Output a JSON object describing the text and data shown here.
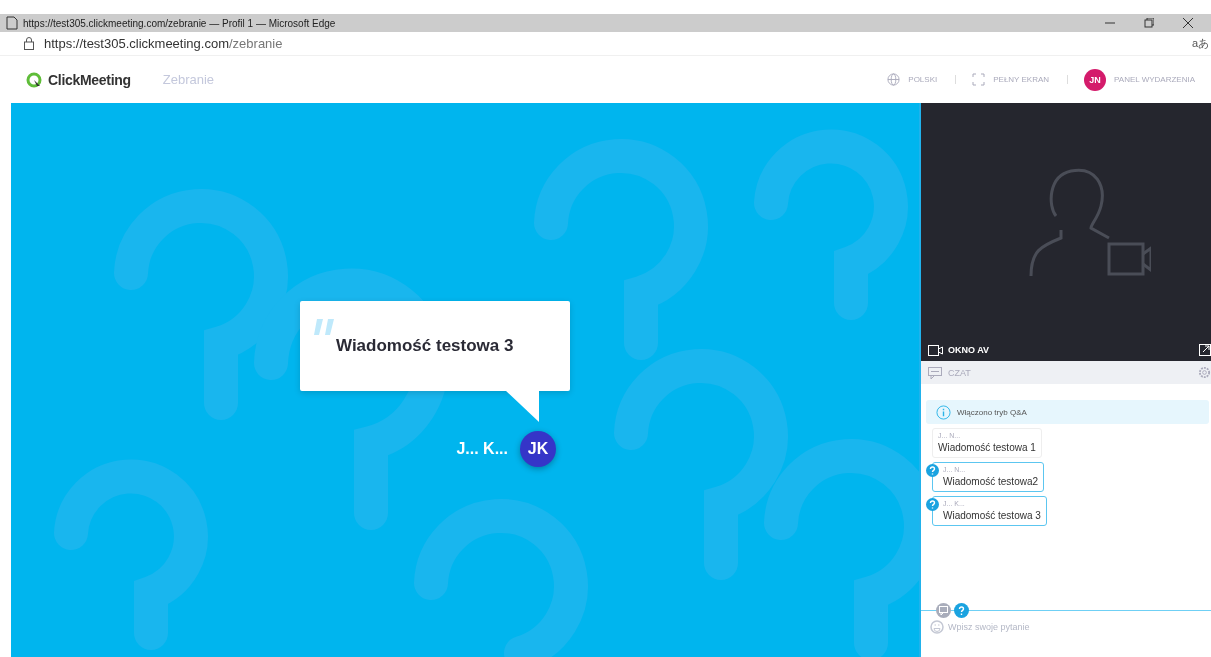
{
  "window": {
    "title": "https://test305.clickmeeting.com/zebranie — Profil 1 — Microsoft Edge"
  },
  "address_bar": {
    "url_host": "https://test305.clickmeeting.com",
    "url_path": "/zebranie",
    "side_text": "aあ"
  },
  "header": {
    "logo": "ClickMeeting",
    "room": "Zebranie",
    "language": "POLSKI",
    "fullscreen": "PEŁNY EKRAN",
    "avatar": "JN",
    "panel": "PANEL WYDARZENIA"
  },
  "stage": {
    "message": "Wiadomość testowa 3",
    "author": "J... K...",
    "avatar": "JK"
  },
  "av_window": {
    "label": "OKNO AV"
  },
  "chat": {
    "label": "CZAT",
    "notice": "Włączono tryb Q&A",
    "messages": [
      {
        "author": "J... N...",
        "text": "Wiadomość testowa 1",
        "question": false
      },
      {
        "author": "J... N...",
        "text": "Wiadomość testowa2",
        "question": true
      },
      {
        "author": "J... K...",
        "text": "Wiadomość testowa 3",
        "question": true
      }
    ],
    "modes": [
      {
        "kind": "chat",
        "selected": false
      },
      {
        "kind": "question",
        "selected": true
      }
    ],
    "placeholder": "Wpisz swoje pytanie"
  }
}
